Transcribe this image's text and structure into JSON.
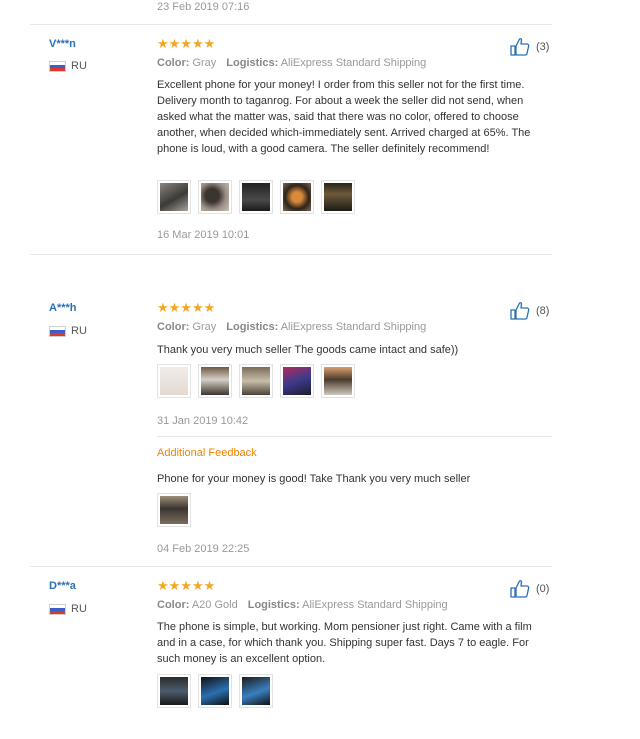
{
  "top": {
    "date": "23 Feb 2019 07:16"
  },
  "labels": {
    "color": "Color:",
    "logistics": "Logistics:",
    "additional_feedback": "Additional Feedback"
  },
  "stars_text": "★★★★★",
  "reviews": [
    {
      "user": "V***n",
      "country": "RU",
      "rating": 5,
      "color_value": "Gray",
      "logistics_value": "AliExpress Standard Shipping",
      "helpful_count": "(3)",
      "text": "Excellent phone for your money! I order from this seller not for the first time. Delivery month to taganrog. For about a week the seller did not send, when asked what the matter was, said that there was no color, offered to choose another, when decided which-immediately sent. Arrived charged at 65%. The phone is loud, with a good camera. The seller definitely recommend!",
      "photos": [
        "photo",
        "photo",
        "photo",
        "photo",
        "photo"
      ],
      "date": "16 Mar 2019 10:01"
    },
    {
      "user": "A***h",
      "country": "RU",
      "rating": 5,
      "color_value": "Gray",
      "logistics_value": "AliExpress Standard Shipping",
      "helpful_count": "(8)",
      "text": "Thank you very much seller The goods came intact and safe))",
      "photos": [
        "photo",
        "photo",
        "photo",
        "photo",
        "photo"
      ],
      "date": "31 Jan 2019 10:42",
      "additional": {
        "text": "Phone for your money is good! Take Thank you very much seller",
        "photos": [
          "photo"
        ],
        "date": "04 Feb 2019 22:25"
      }
    },
    {
      "user": "D***a",
      "country": "RU",
      "rating": 5,
      "color_value": "A20 Gold",
      "logistics_value": "AliExpress Standard Shipping",
      "helpful_count": "(0)",
      "text": "The phone is simple, but working. Mom pensioner just right. Came with a film and in a case, for which thank you. Shipping super fast. Days 7 to eagle. For such money is an excellent option.",
      "photos": [
        "photo",
        "photo",
        "photo"
      ]
    }
  ],
  "colors": {
    "username": "#2a6fb4",
    "stars": "#f5a623",
    "additional_feedback": "#f08300",
    "thumb_icon": "#2a6fb4"
  },
  "icons": {
    "helpful": "thumbs-up-icon",
    "flag": "russia-flag-icon"
  }
}
